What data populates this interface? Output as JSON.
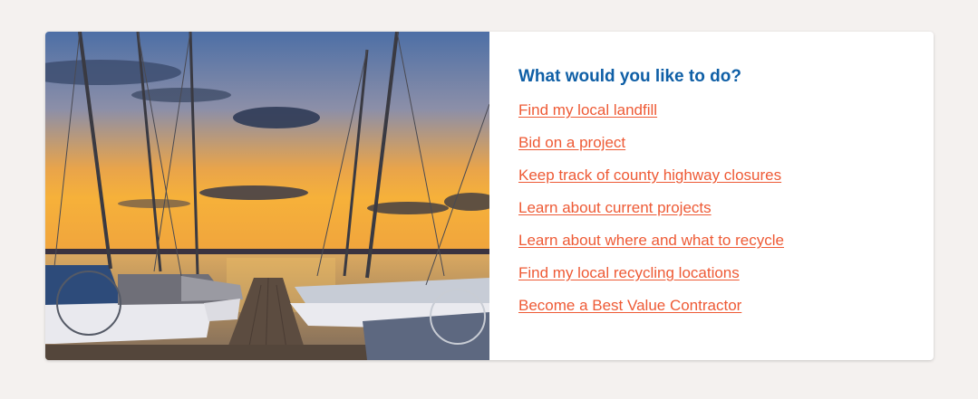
{
  "hero_image": {
    "alt": "Sailboats docked at a pier at sunset",
    "colors": {
      "sky_top": "#4a6fa8",
      "sky_horizon": "#f5a93a",
      "water": "#c9a067",
      "dock": "#6b5a4a"
    }
  },
  "panel": {
    "heading": "What would you like to do?",
    "heading_color": "#0f5fa6",
    "link_color": "#ee5a35",
    "links": [
      {
        "label": "Find my local landfill"
      },
      {
        "label": "Bid on a project"
      },
      {
        "label": "Keep track of county highway closures"
      },
      {
        "label": "Learn about current projects"
      },
      {
        "label": "Learn about where and what to recycle"
      },
      {
        "label": "Find my local recycling locations"
      },
      {
        "label": "Become a Best Value Contractor"
      }
    ]
  }
}
